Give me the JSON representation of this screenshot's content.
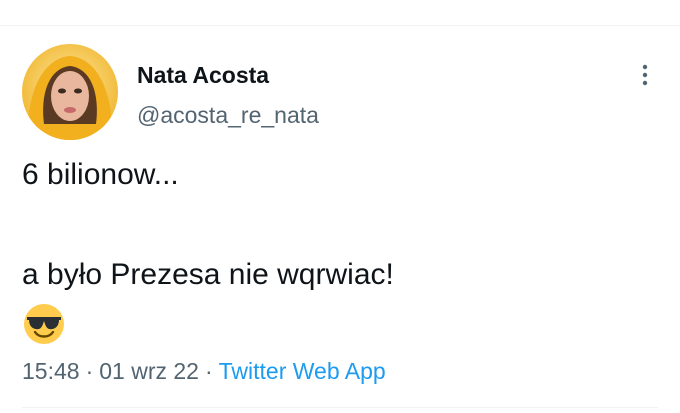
{
  "tweet": {
    "author": {
      "display_name": "Nata Acosta",
      "handle": "@acosta_re_nata"
    },
    "text_line_1": "6 bilionow...",
    "text_line_2": "a było Prezesa nie wqrwiac!",
    "emoji": "smiling-face-with-sunglasses",
    "time": "15:48",
    "separator": "·",
    "date": "01 wrz 22",
    "source": "Twitter Web App"
  },
  "colors": {
    "text_primary": "#0f1419",
    "text_secondary": "#536471",
    "link_blue": "#1d9bf0",
    "divider": "#eff3f4",
    "emoji_yellow": "#ffcc4d"
  },
  "icons": {
    "more": "more-vertical-icon",
    "emoji": "sunglasses-emoji-icon"
  }
}
